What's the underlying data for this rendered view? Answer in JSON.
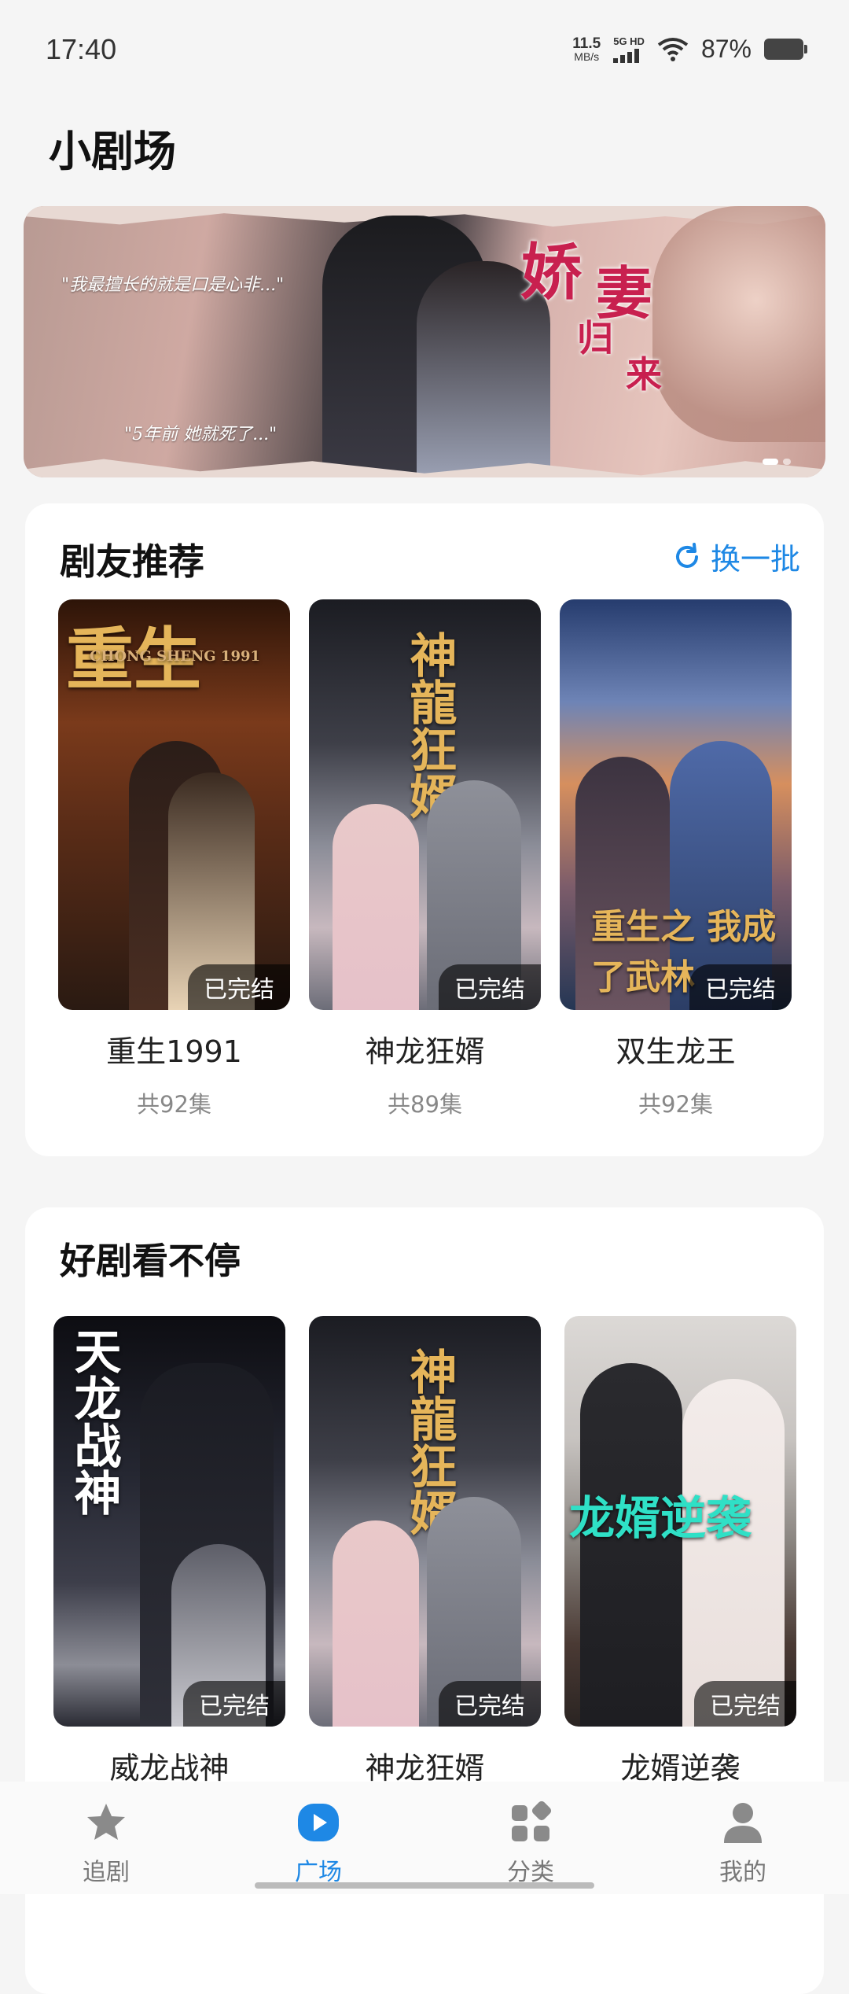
{
  "status_bar": {
    "time": "17:40",
    "net_speed_value": "11.5",
    "net_speed_unit": "MB/s",
    "network_type": "5G HD",
    "battery_percent": "87%"
  },
  "page": {
    "title": "小剧场"
  },
  "banner": {
    "title_chars": [
      "娇",
      "妻",
      "归",
      "来"
    ],
    "quote_1": "\"我最擅长的就是口是心非...\"",
    "quote_2": "\"5年前 她就死了...\"",
    "page_count": 2,
    "active_page": 1
  },
  "recommend": {
    "title": "剧友推荐",
    "refresh_label": "换一批",
    "items": [
      {
        "name": "重生1991",
        "count": "共92集",
        "badge": "已完结",
        "poster_text": "重生",
        "poster_sub": "CHONG SHENG 1991"
      },
      {
        "name": "神龙狂婿",
        "count": "共89集",
        "badge": "已完结",
        "poster_text": "神龍狂婿"
      },
      {
        "name": "双生龙王",
        "count": "共92集",
        "badge": "已完结",
        "poster_text": "重生之 我成了武林"
      }
    ]
  },
  "good": {
    "title": "好剧看不停",
    "items": [
      {
        "name": "威龙战神",
        "badge": "已完结",
        "poster_text": "天龙战神"
      },
      {
        "name": "神龙狂婿",
        "badge": "已完结",
        "poster_text": "神龍狂婿"
      },
      {
        "name": "龙婿逆袭",
        "badge": "已完结",
        "poster_text": "龙婿逆袭"
      }
    ]
  },
  "tabbar": {
    "tabs": [
      {
        "label": "追剧",
        "icon": "star-icon",
        "active": false
      },
      {
        "label": "广场",
        "icon": "play-icon",
        "active": true
      },
      {
        "label": "分类",
        "icon": "grid-icon",
        "active": false
      },
      {
        "label": "我的",
        "icon": "person-icon",
        "active": false
      }
    ]
  },
  "colors": {
    "accent": "#1e88e5",
    "background": "#f5f5f5",
    "card": "#ffffff",
    "badge_bg": "rgba(0,0,0,0.6)"
  }
}
